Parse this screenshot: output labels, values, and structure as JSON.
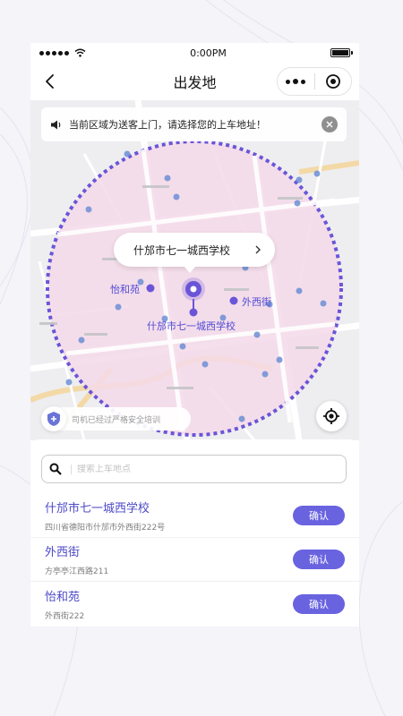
{
  "status_bar": {
    "time": "0:00PM"
  },
  "nav": {
    "title": "出发地"
  },
  "map": {
    "notice": "当前区域为送客上门，请选择您的上车地址！",
    "callout": "什邡市七一城西学校",
    "labels": {
      "yiheyuan": "怡和苑",
      "waixijie": "外西街",
      "school": "什邡市七一城西学校"
    },
    "safety_text": "司机已经过严格安全培训"
  },
  "search": {
    "placeholder": "搜索上车地点",
    "value": ""
  },
  "places": [
    {
      "name": "什邡市七一城西学校",
      "address": "四川省德阳市什邡市外西街222号",
      "button": "确认"
    },
    {
      "name": "外西街",
      "address": "方亭亭江西路211",
      "button": "确认"
    },
    {
      "name": "怡和苑",
      "address": "外西街222",
      "button": "确认"
    }
  ],
  "colors": {
    "accent": "#6963e0",
    "zone_fill": "#f5d9e9",
    "zone_border": "#6a55d8"
  }
}
